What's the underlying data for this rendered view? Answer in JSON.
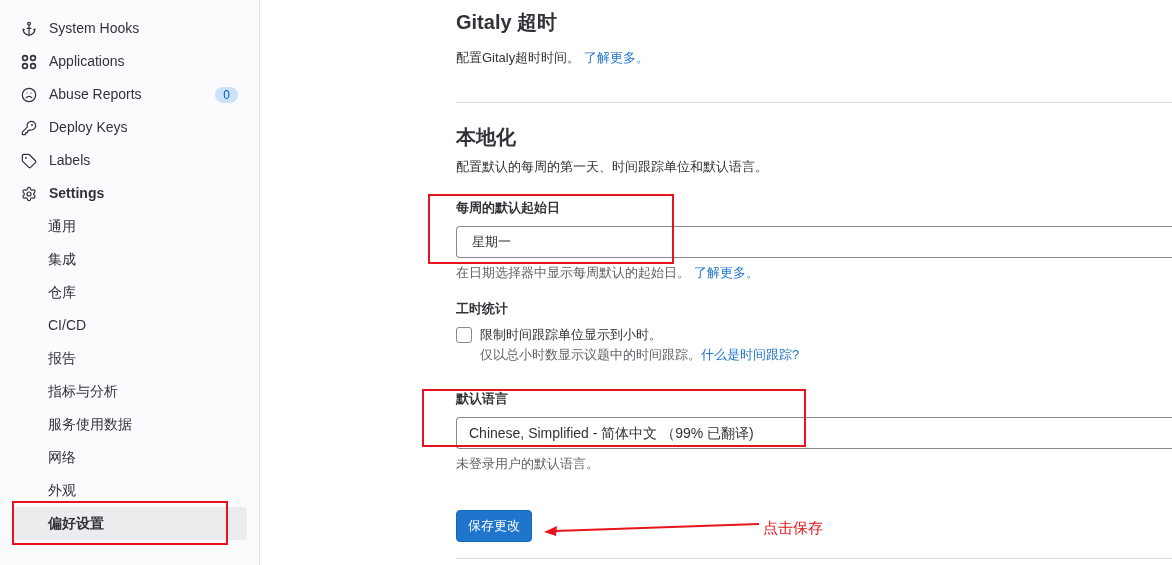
{
  "sidebar": {
    "items": [
      {
        "label": "System Hooks",
        "kind": "anchor",
        "selected": false
      },
      {
        "label": "Applications",
        "kind": "grid",
        "selected": false
      },
      {
        "label": "Abuse Reports",
        "kind": "frown",
        "badge": "0",
        "selected": false
      },
      {
        "label": "Deploy Keys",
        "kind": "key",
        "selected": false
      },
      {
        "label": "Labels",
        "kind": "tag",
        "selected": false
      },
      {
        "label": "Settings",
        "kind": "gear",
        "selected": false,
        "children": [
          {
            "label": "通用",
            "selected": false
          },
          {
            "label": "集成",
            "selected": false
          },
          {
            "label": "仓库",
            "selected": false
          },
          {
            "label": "CI/CD",
            "selected": false
          },
          {
            "label": "报告",
            "selected": false
          },
          {
            "label": "指标与分析",
            "selected": false
          },
          {
            "label": "服务使用数据",
            "selected": false
          },
          {
            "label": "网络",
            "selected": false
          },
          {
            "label": "外观",
            "selected": false
          },
          {
            "label": "偏好设置",
            "selected": true
          }
        ]
      }
    ]
  },
  "gitaly": {
    "title": "Gitaly 超时",
    "description": "配置Gitaly超时时间。",
    "link": "了解更多。"
  },
  "localization": {
    "title": "本地化",
    "description": "配置默认的每周的第一天、时间跟踪单位和默认语言。",
    "first_day": {
      "label": "每周的默认起始日",
      "value": "星期一",
      "help": "在日期选择器中显示每周默认的起始日。",
      "link": "了解更多。"
    },
    "time_tracking": {
      "label": "工时统计",
      "checkbox": {
        "label": "限制时间跟踪单位显示到小时。",
        "checked": false
      },
      "help": "仅以总小时数显示议题中的时间跟踪。",
      "link": "什么是时间跟踪?"
    },
    "language": {
      "label": "默认语言",
      "value": "Chinese, Simplified - 简体中文 （99% 已翻译)",
      "help": "未登录用户的默认语言。"
    },
    "save_button": "保存更改"
  },
  "annotation": {
    "text": "点击保存"
  }
}
